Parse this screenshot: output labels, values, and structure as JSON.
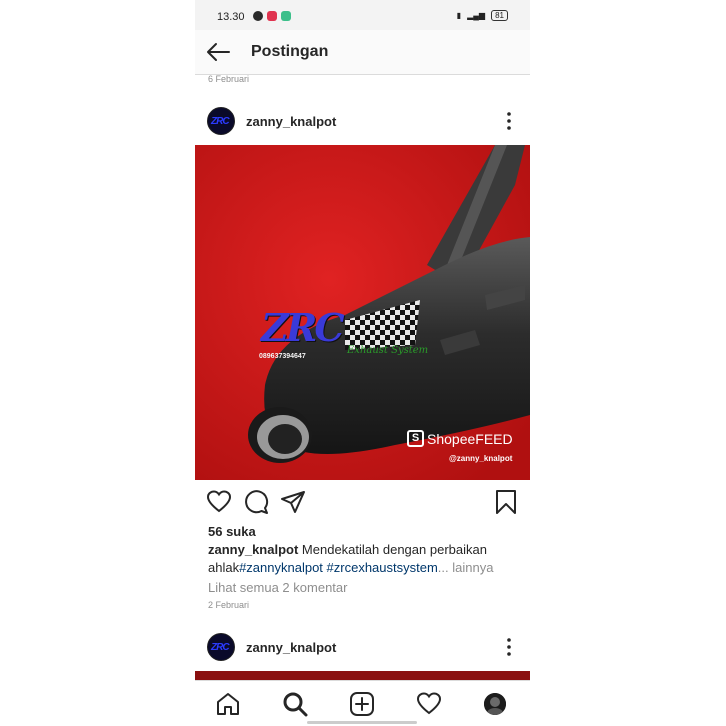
{
  "status_bar": {
    "time": "13.30",
    "battery": "81"
  },
  "header": {
    "title": "Postingan"
  },
  "previous_post": {
    "date": "6 Februari"
  },
  "post": {
    "username": "zanny_knalpot",
    "avatar_text": "ZRC",
    "image": {
      "logo_text": "ZRC",
      "logo_subtitle": "Exhaust System",
      "phone_text": "089637394647",
      "shopee_text": "ShopeeFEED",
      "shopee_handle": "@zanny_knalpot"
    },
    "likes": "56 suka",
    "caption": {
      "user": "zanny_knalpot",
      "text": "Mendekatilah dengan perbaikan ahlak",
      "tags": "#zannyknalpot #zrcexhaustsystem",
      "ellipsis": "...",
      "more": "lainnya"
    },
    "comments_link": "Lihat semua 2 komentar",
    "date": "2 Februari"
  },
  "next_post": {
    "username": "zanny_knalpot",
    "avatar_text": "ZRC"
  },
  "colors": {
    "accent_blue": "#00376b",
    "muted": "#8e8e8e",
    "image_red": "#c81818"
  },
  "icons": {
    "header": [
      "back-arrow-icon",
      "more-vertical-icon"
    ],
    "actions": [
      "heart-icon",
      "comment-icon",
      "share-icon",
      "bookmark-icon"
    ],
    "nav": [
      "home-icon",
      "search-icon",
      "add-post-icon",
      "activity-heart-icon",
      "profile-avatar"
    ]
  }
}
